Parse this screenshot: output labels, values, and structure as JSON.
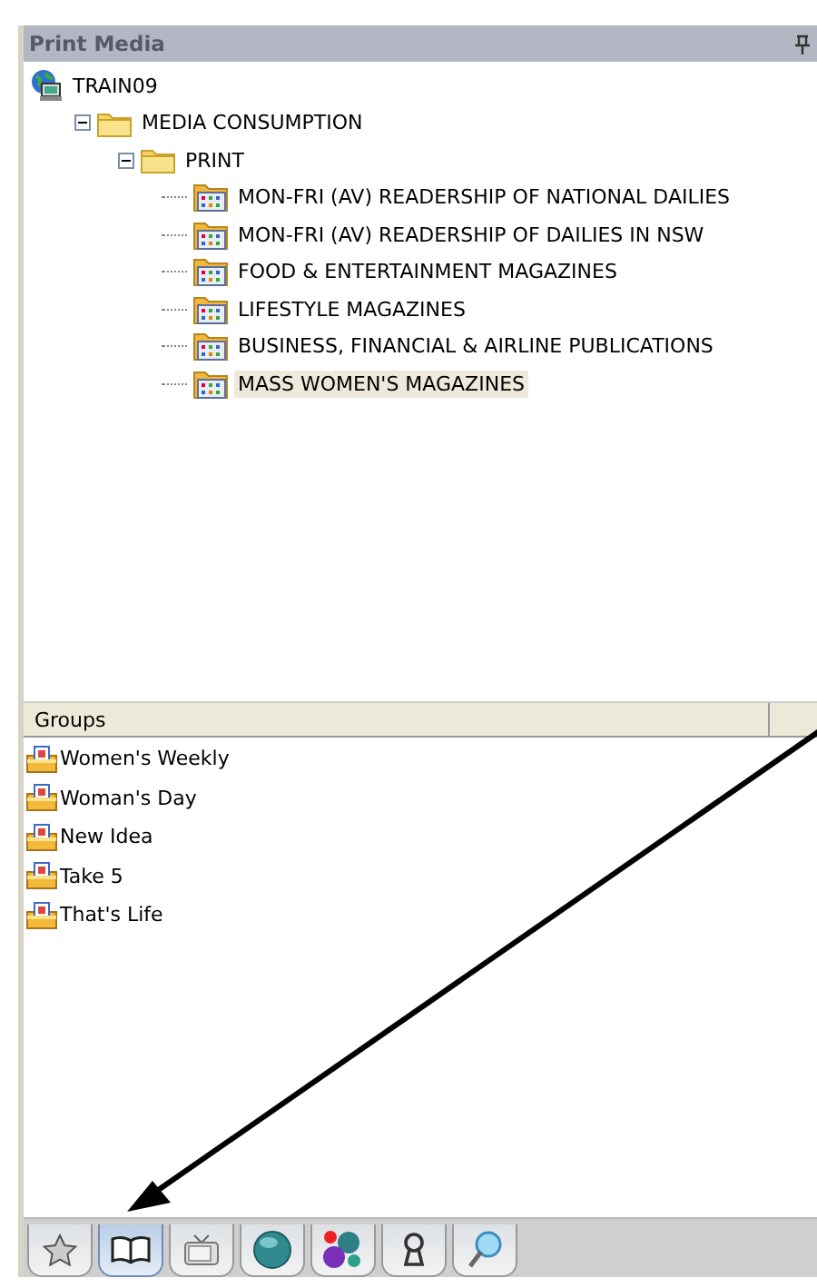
{
  "panel": {
    "title": "Print Media"
  },
  "tree": [
    {
      "label": "TRAIN09",
      "kind": "server",
      "children": [
        {
          "label": "MEDIA CONSUMPTION",
          "kind": "folder",
          "expanded": true,
          "children": [
            {
              "label": "PRINT",
              "kind": "folder",
              "expanded": true,
              "children": [
                {
                  "label": "MON-FRI (AV) READERSHIP OF NATIONAL DAILIES",
                  "kind": "table",
                  "selected": false
                },
                {
                  "label": "MON-FRI (AV) READERSHIP OF DAILIES IN NSW",
                  "kind": "table",
                  "selected": false
                },
                {
                  "label": "FOOD & ENTERTAINMENT MAGAZINES",
                  "kind": "table",
                  "selected": false
                },
                {
                  "label": "LIFESTYLE MAGAZINES",
                  "kind": "table",
                  "selected": false
                },
                {
                  "label": "BUSINESS, FINANCIAL & AIRLINE PUBLICATIONS",
                  "kind": "table",
                  "selected": false
                },
                {
                  "label": "MASS WOMEN'S MAGAZINES",
                  "kind": "table",
                  "selected": true
                }
              ]
            }
          ]
        }
      ]
    }
  ],
  "groups": {
    "columns": [
      "Groups"
    ],
    "items": [
      {
        "label": "Women's Weekly"
      },
      {
        "label": "Woman's Day"
      },
      {
        "label": "New Idea"
      },
      {
        "label": "Take 5"
      },
      {
        "label": "That's Life"
      }
    ]
  },
  "tabs": [
    {
      "kind": "star",
      "selected": false
    },
    {
      "kind": "book",
      "selected": true
    },
    {
      "kind": "tv",
      "selected": false
    },
    {
      "kind": "globe",
      "selected": false
    },
    {
      "kind": "dots",
      "selected": false
    },
    {
      "kind": "keyhole",
      "selected": false
    },
    {
      "kind": "magnifier",
      "selected": false
    }
  ]
}
